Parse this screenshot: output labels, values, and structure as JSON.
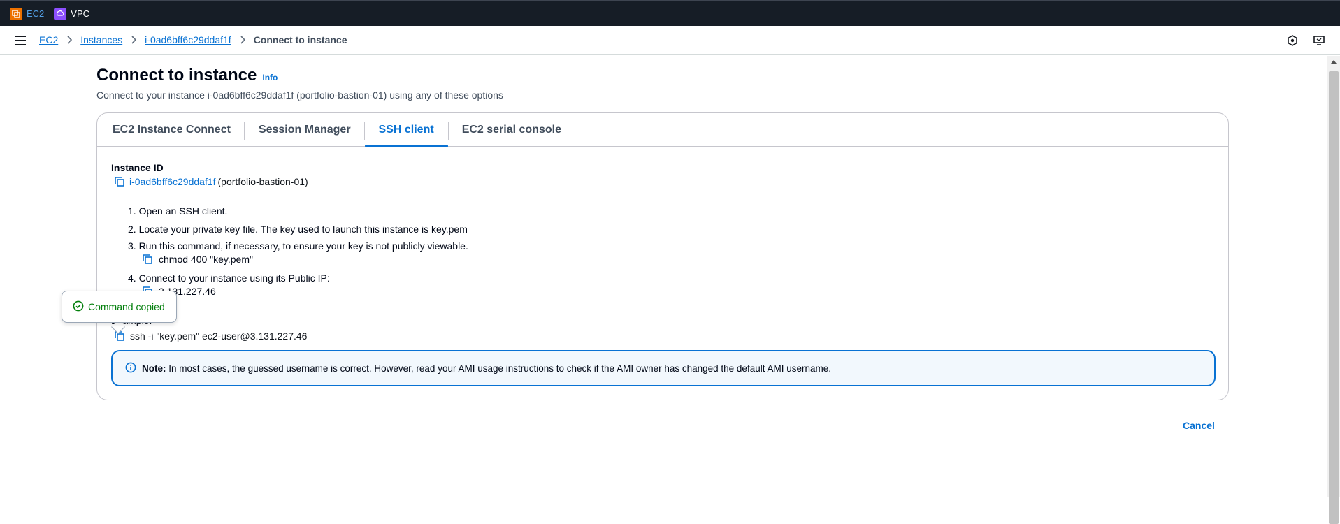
{
  "topbar": {
    "services": [
      {
        "label": "EC2",
        "icon": "ec2-icon"
      },
      {
        "label": "VPC",
        "icon": "vpc-icon"
      }
    ]
  },
  "breadcrumb": {
    "items": [
      "EC2",
      "Instances",
      "i-0ad6bff6c29ddaf1f"
    ],
    "current": "Connect to instance"
  },
  "page": {
    "title": "Connect to instance",
    "info": "Info",
    "subtitle": "Connect to your instance i-0ad6bff6c29ddaf1f (portfolio-bastion-01) using any of these options"
  },
  "tabs": [
    {
      "label": "EC2 Instance Connect",
      "active": false
    },
    {
      "label": "Session Manager",
      "active": false
    },
    {
      "label": "SSH client",
      "active": true
    },
    {
      "label": "EC2 serial console",
      "active": false
    }
  ],
  "ssh": {
    "instance_label": "Instance ID",
    "instance_id": "i-0ad6bff6c29ddaf1f",
    "instance_name": "(portfolio-bastion-01)",
    "step1": "1. Open an SSH client.",
    "step2": "2. Locate your private key file. The key used to launch this instance is key.pem",
    "step3": "3. Run this command, if necessary, to ensure your key is not publicly viewable.",
    "chmod_cmd": "chmod 400 \"key.pem\"",
    "step4": "4. Connect to your instance using its Public IP:",
    "public_ip": "3.131.227.46",
    "example_label": "Example:",
    "ssh_cmd": "ssh -i \"key.pem\" ec2-user@3.131.227.46"
  },
  "note": {
    "bold": "Note:",
    "text": "In most cases, the guessed username is correct. However, read your AMI usage instructions to check if the AMI owner has changed the default AMI username."
  },
  "popover": {
    "text": "Command copied"
  },
  "footer": {
    "cancel": "Cancel"
  },
  "colors": {
    "link": "#0972d3",
    "success": "#037f0c",
    "topbar": "#161d26"
  }
}
